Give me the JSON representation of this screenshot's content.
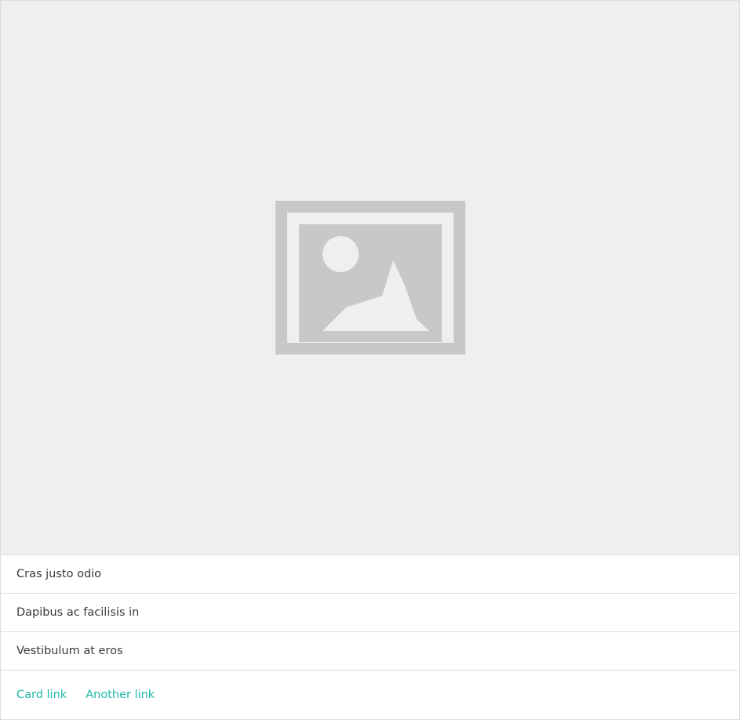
{
  "card": {
    "image": {
      "icon": "image-placeholder-icon",
      "icon_color": "#c8c8c8",
      "background": "#f0eff0"
    },
    "list_items": [
      {
        "label": "Cras justo odio"
      },
      {
        "label": "Dapibus ac facilisis in"
      },
      {
        "label": "Vestibulum at eros"
      }
    ],
    "links": [
      {
        "label": "Card link"
      },
      {
        "label": "Another link"
      }
    ],
    "accent_color": "#22b8a9"
  }
}
